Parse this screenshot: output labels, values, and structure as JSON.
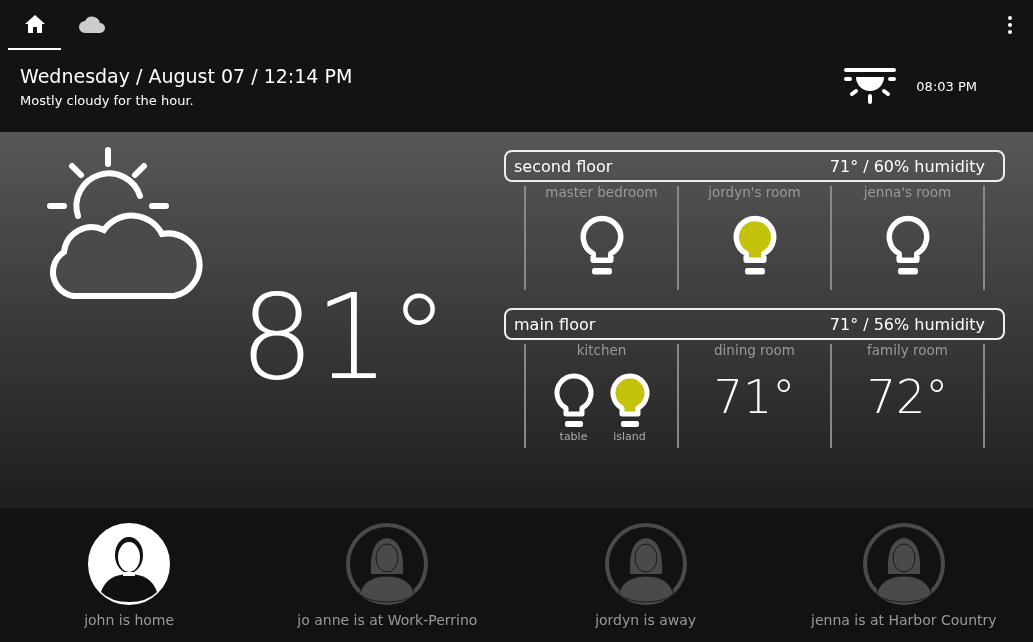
{
  "tabs": [
    {
      "kind": "home",
      "selected": true
    },
    {
      "kind": "weather",
      "selected": false
    }
  ],
  "header": {
    "date": "Wednesday / August 07 / 12:14 PM",
    "forecast": "Mostly cloudy for the hour.",
    "sunset": "08:03 PM"
  },
  "outdoor": {
    "temperature": "81°"
  },
  "floors": [
    {
      "name": "second floor",
      "climate": "71° / 60% humidity",
      "rooms": [
        {
          "name": "master bedroom",
          "kind": "lights",
          "lights": [
            {
              "on": false
            }
          ]
        },
        {
          "name": "jordyn's room",
          "kind": "lights",
          "lights": [
            {
              "on": true
            }
          ]
        },
        {
          "name": "jenna's room",
          "kind": "lights",
          "lights": [
            {
              "on": false
            }
          ]
        }
      ]
    },
    {
      "name": "main floor",
      "climate": "71° / 56% humidity",
      "rooms": [
        {
          "name": "kitchen",
          "kind": "lights",
          "lights": [
            {
              "label": "table",
              "on": false
            },
            {
              "label": "island",
              "on": true
            }
          ]
        },
        {
          "name": "dining room",
          "kind": "temp",
          "temperature": "71°"
        },
        {
          "name": "family room",
          "kind": "temp",
          "temperature": "72°"
        }
      ]
    }
  ],
  "people": [
    {
      "status": "john is home",
      "kind": "man",
      "home": true
    },
    {
      "status": "jo anne is at Work-Perrino",
      "kind": "woman",
      "home": false
    },
    {
      "status": "jordyn is away",
      "kind": "woman",
      "home": false
    },
    {
      "status": "jenna is at Harbor Country",
      "kind": "woman",
      "home": false
    }
  ]
}
